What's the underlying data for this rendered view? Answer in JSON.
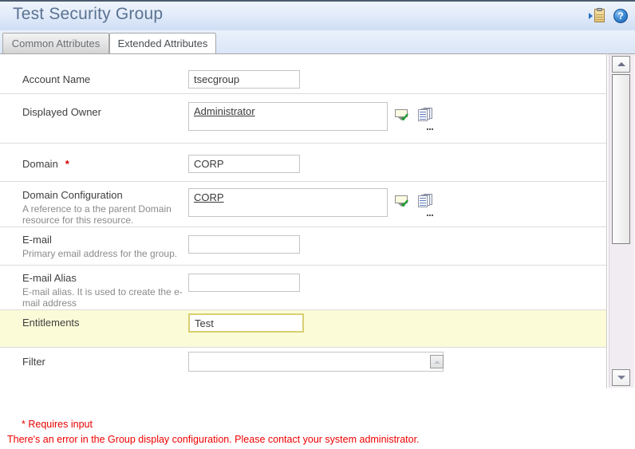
{
  "header": {
    "title": "Test Security Group",
    "icons": [
      {
        "name": "add-to-clipboard-icon"
      },
      {
        "name": "help-icon",
        "glyph": "?"
      }
    ]
  },
  "tabs": [
    {
      "label": "Common Attributes",
      "active": false
    },
    {
      "label": "Extended Attributes",
      "active": true
    }
  ],
  "form": {
    "rows": [
      {
        "label": "Account Name",
        "description": "",
        "value": "tsecgroup",
        "required": false,
        "highlighted": false,
        "control": "text"
      },
      {
        "label": "Displayed Owner",
        "description": "",
        "value": "Administrator",
        "required": false,
        "highlighted": false,
        "control": "resource-link"
      },
      {
        "label": "Domain",
        "description": "",
        "value": "CORP",
        "required": true,
        "highlighted": false,
        "control": "text"
      },
      {
        "label": "Domain Configuration",
        "description": "A reference to a the parent Domain resource for this resource.",
        "value": "CORP",
        "required": false,
        "highlighted": false,
        "control": "resource-link"
      },
      {
        "label": "E-mail",
        "description": "Primary email address for the group.",
        "value": "",
        "required": false,
        "highlighted": false,
        "control": "text"
      },
      {
        "label": "E-mail Alias",
        "description": "E-mail alias. It is used to create the e-mail address",
        "value": "",
        "required": false,
        "highlighted": false,
        "control": "text"
      },
      {
        "label": "Entitlements",
        "description": "",
        "value": "Test",
        "required": false,
        "highlighted": true,
        "control": "text"
      },
      {
        "label": "Filter",
        "description": "",
        "value": "",
        "required": false,
        "highlighted": false,
        "control": "filter"
      }
    ],
    "required_marker": "*"
  },
  "footer": {
    "requires_input_note": "* Requires input",
    "error_message": "There's an error in the Group display configuration. Please contact your system administrator."
  },
  "colors": {
    "error_red": "#ef0000",
    "required_red": "#d00000",
    "header_title": "#5a7291",
    "highlight_row": "#fbfbd8",
    "highlight_border": "#d8cf70"
  }
}
